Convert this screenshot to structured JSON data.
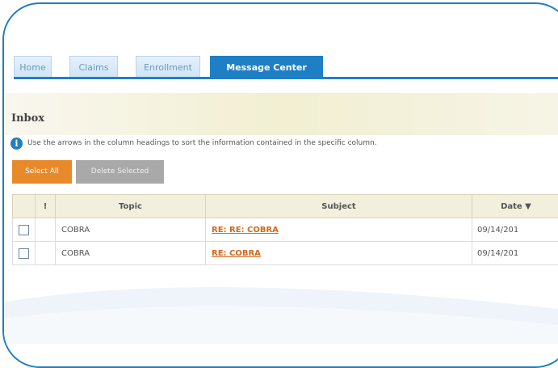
{
  "nav": {
    "tabs": [
      {
        "label": "Home",
        "active": false
      },
      {
        "label": "Claims",
        "active": false
      },
      {
        "label": "Enrollment",
        "active": false
      },
      {
        "label": "Message Center",
        "active": true
      }
    ]
  },
  "inbox": {
    "title": "Inbox",
    "info_text": "Use the arrows in the column headings to sort the information contained in the specific column.",
    "buttons": {
      "select_all": "Select All",
      "delete_selected": "Delete Selected"
    },
    "table": {
      "headers": {
        "flag": "!",
        "topic": "Topic",
        "subject": "Subject",
        "date": "Date ▼"
      },
      "rows": [
        {
          "topic": "COBRA",
          "subject": "RE: RE: COBRA",
          "date": "09/14/201"
        },
        {
          "topic": "COBRA",
          "subject": "RE: COBRA",
          "date": "09/14/201"
        }
      ]
    }
  },
  "colors": {
    "frame": "#1f7fc0",
    "accent_tab": "#1f7fc4",
    "select_button": "#e98a2a",
    "delete_button": "#a9a9a9",
    "link": "#d2691e"
  }
}
